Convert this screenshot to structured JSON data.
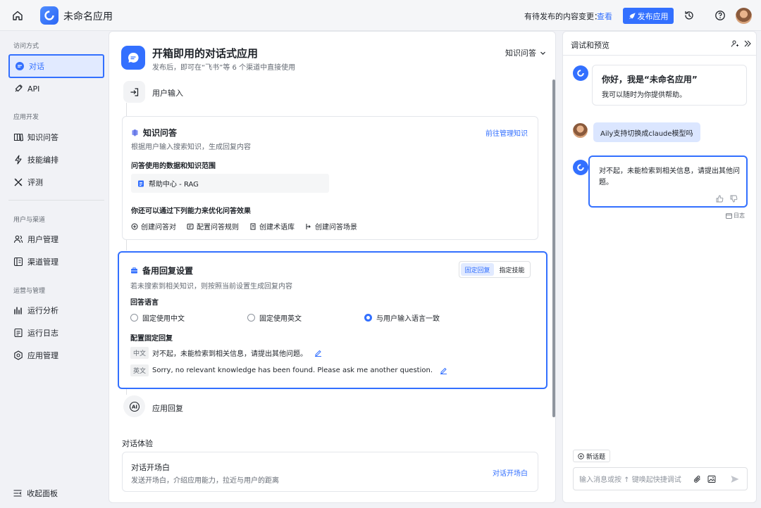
{
  "topbar": {
    "app_name": "未命名应用",
    "pending_text": "有待发布的内容变更：",
    "view_link": "查看",
    "publish_label": "发布应用"
  },
  "sidebar": {
    "groups": [
      {
        "title": "访问方式",
        "items": [
          {
            "label": "对话",
            "icon": "chat-icon",
            "active": true
          },
          {
            "label": "API",
            "icon": "api-icon"
          }
        ]
      },
      {
        "title": "应用开发",
        "items": [
          {
            "label": "知识问答",
            "icon": "book-icon"
          },
          {
            "label": "技能编排",
            "icon": "lightning-icon"
          },
          {
            "label": "评测",
            "icon": "tools-icon"
          }
        ]
      },
      {
        "title": "用户与渠道",
        "items": [
          {
            "label": "用户管理",
            "icon": "users-icon"
          },
          {
            "label": "渠道管理",
            "icon": "channel-icon"
          }
        ]
      },
      {
        "title": "运营与管理",
        "items": [
          {
            "label": "运行分析",
            "icon": "bar-chart-icon"
          },
          {
            "label": "运行日志",
            "icon": "log-icon"
          },
          {
            "label": "应用管理",
            "icon": "gear-icon"
          }
        ]
      }
    ],
    "collapse_label": "收起面板"
  },
  "main": {
    "title": "开箱即用的对话式应用",
    "subtitle": "发布后，即可在“飞书”等 6 个渠道中直接使用",
    "dropdown": "知识问答",
    "user_input": "用户输入",
    "kb_card": {
      "title": "知识问答",
      "link": "前往管理知识",
      "desc": "根据用户输入搜索知识，生成回复内容",
      "scope_label": "问答使用的数据和知识范围",
      "kb_name": "帮助中心 - RAG",
      "optimize_label": "你还可以通过下列能力来优化问答效果",
      "options": [
        "创建问答对",
        "配置问答规则",
        "创建术语库",
        "创建问答场景"
      ]
    },
    "fallback_card": {
      "title": "备用回复设置",
      "desc": "若未搜索到相关知识，则按照当前设置生成回复内容",
      "seg_fixed": "固定回复",
      "seg_skill": "指定技能",
      "lang_label": "回答语言",
      "radios": [
        "固定使用中文",
        "固定使用英文",
        "与用户输入语言一致"
      ],
      "fixed_label": "配置固定回复",
      "zh_tag": "中文",
      "zh_text": "对不起，未能检索到相关信息，请提出其他问题。",
      "en_tag": "英文",
      "en_text": "Sorry, no relevant knowledge has been found. Please ask me another question."
    },
    "app_reply": "应用回复",
    "experience_label": "对话体验",
    "opening": {
      "title": "对话开场白",
      "desc": "发送开场白，介绍应用能力，拉近与用户的距离",
      "link": "对话开场白"
    }
  },
  "preview": {
    "title": "调试和预览",
    "greeting_title": "你好，我是“未命名应用”",
    "greeting_sub": "我可以随时为你提供帮助。",
    "user_message": "Aily支持切换成claude模型吗",
    "bot_reply": "对不起，未能检索到相关信息，请提出其他问题。",
    "log_label": "日志",
    "new_topic": "新话题",
    "input_placeholder": "输入消息或按 ↑ 键唤起快捷调试"
  },
  "colors": {
    "accent": "#3370ff",
    "highlight_border": "#3370ff"
  }
}
